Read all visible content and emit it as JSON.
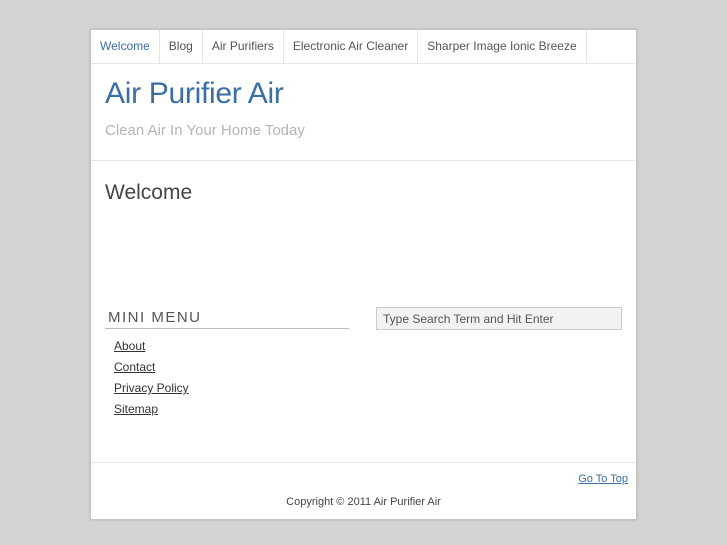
{
  "nav": {
    "items": [
      {
        "label": "Welcome",
        "active": true
      },
      {
        "label": "Blog",
        "active": false
      },
      {
        "label": "Air Purifiers",
        "active": false
      },
      {
        "label": "Electronic Air Cleaner",
        "active": false
      },
      {
        "label": "Sharper Image Ionic Breeze",
        "active": false
      }
    ]
  },
  "header": {
    "title": "Air Purifier Air",
    "tagline": "Clean Air In Your Home Today"
  },
  "main": {
    "page_title": "Welcome"
  },
  "mini_menu": {
    "title": "MINI MENU",
    "items": [
      {
        "label": "About"
      },
      {
        "label": "Contact"
      },
      {
        "label": "Privacy Policy"
      },
      {
        "label": "Sitemap"
      }
    ]
  },
  "search": {
    "placeholder": "Type Search Term and Hit Enter",
    "value": ""
  },
  "footer": {
    "go_top": "Go To Top",
    "copyright": "Copyright © 2011 Air Purifier Air"
  },
  "colors": {
    "accent": "#3a6ea5",
    "background": "#d3d3d3",
    "tagline": "#b5b5b5"
  }
}
